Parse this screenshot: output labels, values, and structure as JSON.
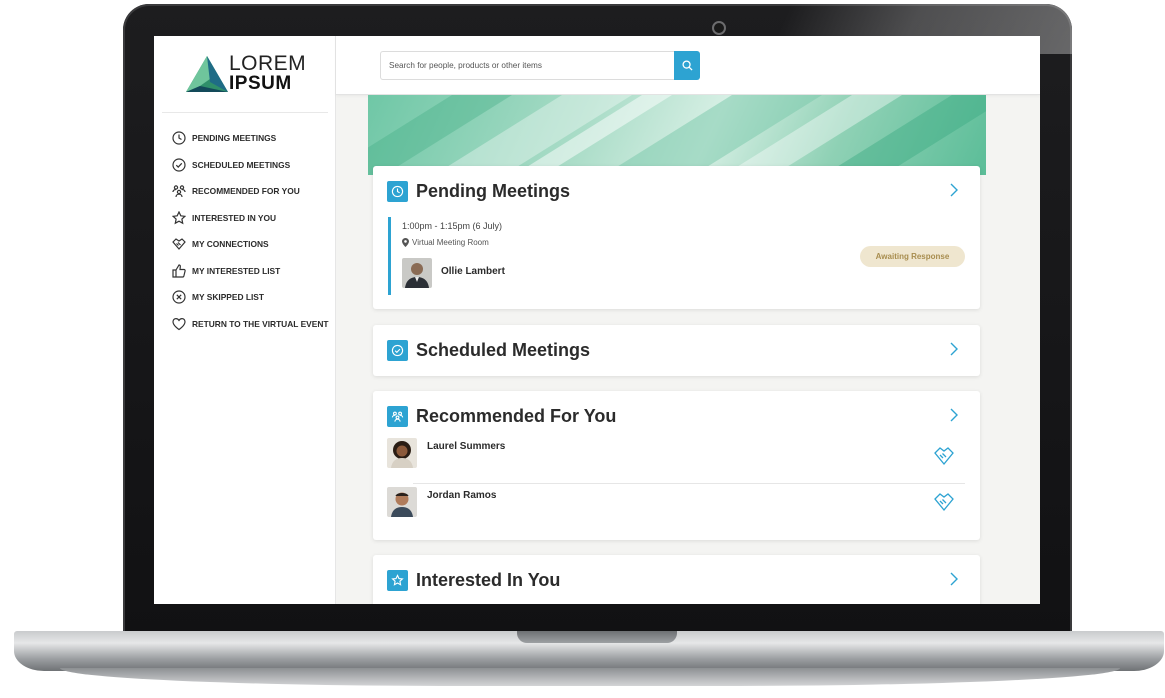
{
  "brand": {
    "line1": "LOREM",
    "line2": "IPSUM"
  },
  "sidebar": {
    "items": [
      {
        "label": "PENDING MEETINGS",
        "icon": "clock-icon"
      },
      {
        "label": "SCHEDULED MEETINGS",
        "icon": "check-circle-icon"
      },
      {
        "label": "RECOMMENDED FOR YOU",
        "icon": "people-icon"
      },
      {
        "label": "INTERESTED IN YOU",
        "icon": "star-icon"
      },
      {
        "label": "MY CONNECTIONS",
        "icon": "handshake-icon"
      },
      {
        "label": "MY INTERESTED LIST",
        "icon": "thumbs-up-icon"
      },
      {
        "label": "MY SKIPPED LIST",
        "icon": "x-circle-icon"
      },
      {
        "label": "RETURN TO THE VIRTUAL EVENT",
        "icon": "heart-icon"
      }
    ]
  },
  "search": {
    "placeholder": "Search for people, products or other items",
    "button_icon": "search-icon"
  },
  "pending": {
    "title": "Pending Meetings",
    "meeting": {
      "time": "1:00pm - 1:15pm (6 July)",
      "location": "Virtual Meeting Room",
      "person": "Ollie Lambert",
      "status": "Awaiting Response"
    }
  },
  "scheduled": {
    "title": "Scheduled Meetings"
  },
  "recommended": {
    "title": "Recommended For You",
    "people": [
      {
        "name": "Laurel Summers"
      },
      {
        "name": "Jordan Ramos"
      }
    ]
  },
  "interested": {
    "title": "Interested In You"
  },
  "colors": {
    "accent": "#2da3d2",
    "badge_bg": "#efe6cf",
    "badge_text": "#a88d4f"
  }
}
